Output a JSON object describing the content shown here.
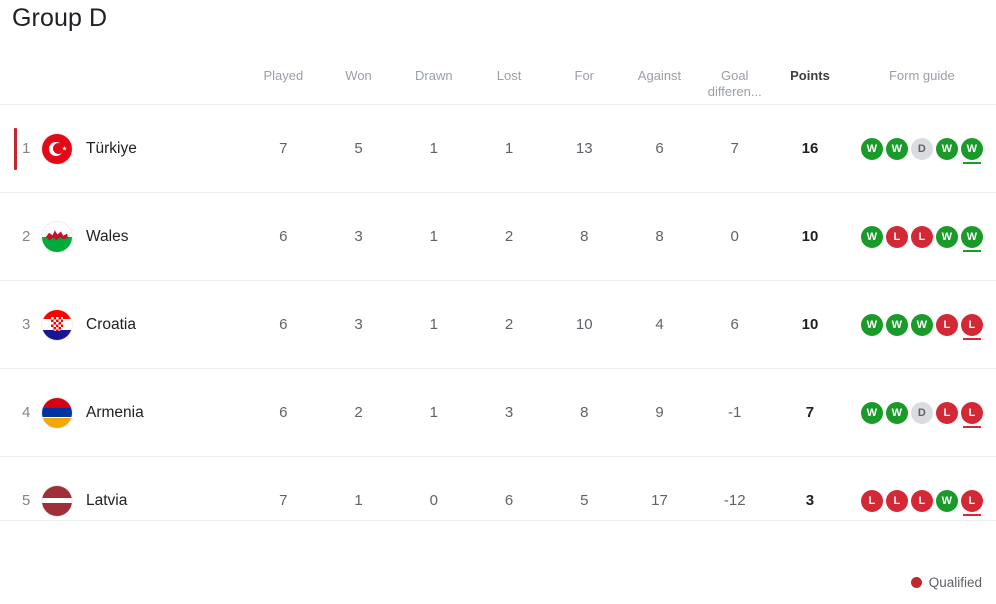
{
  "header": {
    "title": "Group D"
  },
  "table": {
    "columns": [
      {
        "key": "played",
        "label": "Played"
      },
      {
        "key": "won",
        "label": "Won"
      },
      {
        "key": "drawn",
        "label": "Drawn"
      },
      {
        "key": "lost",
        "label": "Lost"
      },
      {
        "key": "for",
        "label": "For"
      },
      {
        "key": "against",
        "label": "Against"
      },
      {
        "key": "gd",
        "label": "Goal differen..."
      },
      {
        "key": "points",
        "label": "Points"
      },
      {
        "key": "form",
        "label": "Form guide"
      }
    ],
    "column_labels": {
      "played": "Played",
      "won": "Won",
      "drawn": "Drawn",
      "lost": "Lost",
      "for": "For",
      "against": "Against",
      "gd_line1": "Goal",
      "gd_line2": "differen...",
      "points": "Points",
      "form": "Form guide"
    },
    "rows": [
      {
        "rank": "1",
        "team": "Türkiye",
        "flag": "flag-turkiye-icon",
        "qualified": true,
        "played": "7",
        "won": "5",
        "drawn": "1",
        "lost": "1",
        "for": "13",
        "against": "6",
        "gd": "7",
        "points": "16",
        "form": [
          "W",
          "W",
          "D",
          "W",
          "W"
        ],
        "form_last_highlighted": true
      },
      {
        "rank": "2",
        "team": "Wales",
        "flag": "flag-wales-icon",
        "qualified": false,
        "played": "6",
        "won": "3",
        "drawn": "1",
        "lost": "2",
        "for": "8",
        "against": "8",
        "gd": "0",
        "points": "10",
        "form": [
          "W",
          "L",
          "L",
          "W",
          "W"
        ],
        "form_last_highlighted": true
      },
      {
        "rank": "3",
        "team": "Croatia",
        "flag": "flag-croatia-icon",
        "qualified": false,
        "played": "6",
        "won": "3",
        "drawn": "1",
        "lost": "2",
        "for": "10",
        "against": "4",
        "gd": "6",
        "points": "10",
        "form": [
          "W",
          "W",
          "W",
          "L",
          "L"
        ],
        "form_last_highlighted": true
      },
      {
        "rank": "4",
        "team": "Armenia",
        "flag": "flag-armenia-icon",
        "qualified": false,
        "played": "6",
        "won": "2",
        "drawn": "1",
        "lost": "3",
        "for": "8",
        "against": "9",
        "gd": "-1",
        "points": "7",
        "form": [
          "W",
          "W",
          "D",
          "L",
          "L"
        ],
        "form_last_highlighted": true
      },
      {
        "rank": "5",
        "team": "Latvia",
        "flag": "flag-latvia-icon",
        "qualified": false,
        "played": "7",
        "won": "1",
        "drawn": "0",
        "lost": "6",
        "for": "5",
        "against": "17",
        "gd": "-12",
        "points": "3",
        "form": [
          "L",
          "L",
          "L",
          "W",
          "L"
        ],
        "form_last_highlighted": true
      }
    ]
  },
  "legend": {
    "items": [
      {
        "label": "Qualified",
        "color": "#c1272d",
        "icon": "status-dot-icon"
      }
    ]
  },
  "colors": {
    "win": "#1a9b29",
    "loss": "#d32836",
    "draw": "#dadce0",
    "qualified": "#c1272d",
    "text_primary": "#202124",
    "text_secondary": "#5f6368",
    "text_muted": "#9aa0a6",
    "row_divider": "#eceef0"
  }
}
